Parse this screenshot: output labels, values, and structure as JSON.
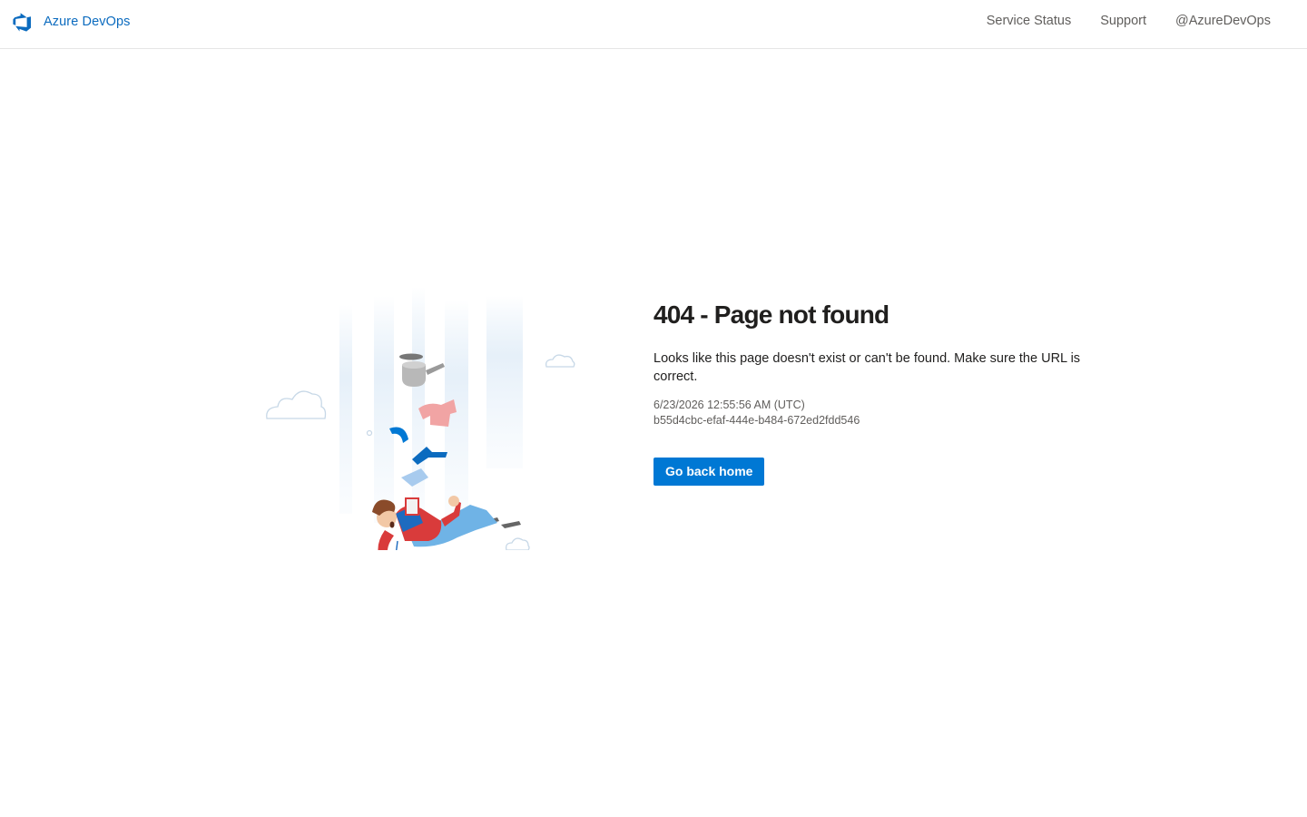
{
  "header": {
    "brand_name": "Azure DevOps",
    "logo_icon": "azure-devops-logo-icon",
    "nav_links": [
      {
        "label": "Service Status"
      },
      {
        "label": "Support"
      },
      {
        "label": "@AzureDevOps"
      }
    ]
  },
  "error": {
    "title": "404 - Page not found",
    "message": "Looks like this page doesn't exist or can't be found. Make sure the URL is correct.",
    "timestamp": "6/23/2026 12:55:56 AM (UTC)",
    "activity_id": "b55d4cbc-efaf-444e-b484-672ed2fdd546",
    "button_label": "Go back home"
  },
  "illustration": {
    "icon": "falling-person-illustration"
  },
  "colors": {
    "brand": "#0b6bbf",
    "primary_button": "#0078d4",
    "nav_text": "#605e5c",
    "title_text": "#201f1e"
  }
}
